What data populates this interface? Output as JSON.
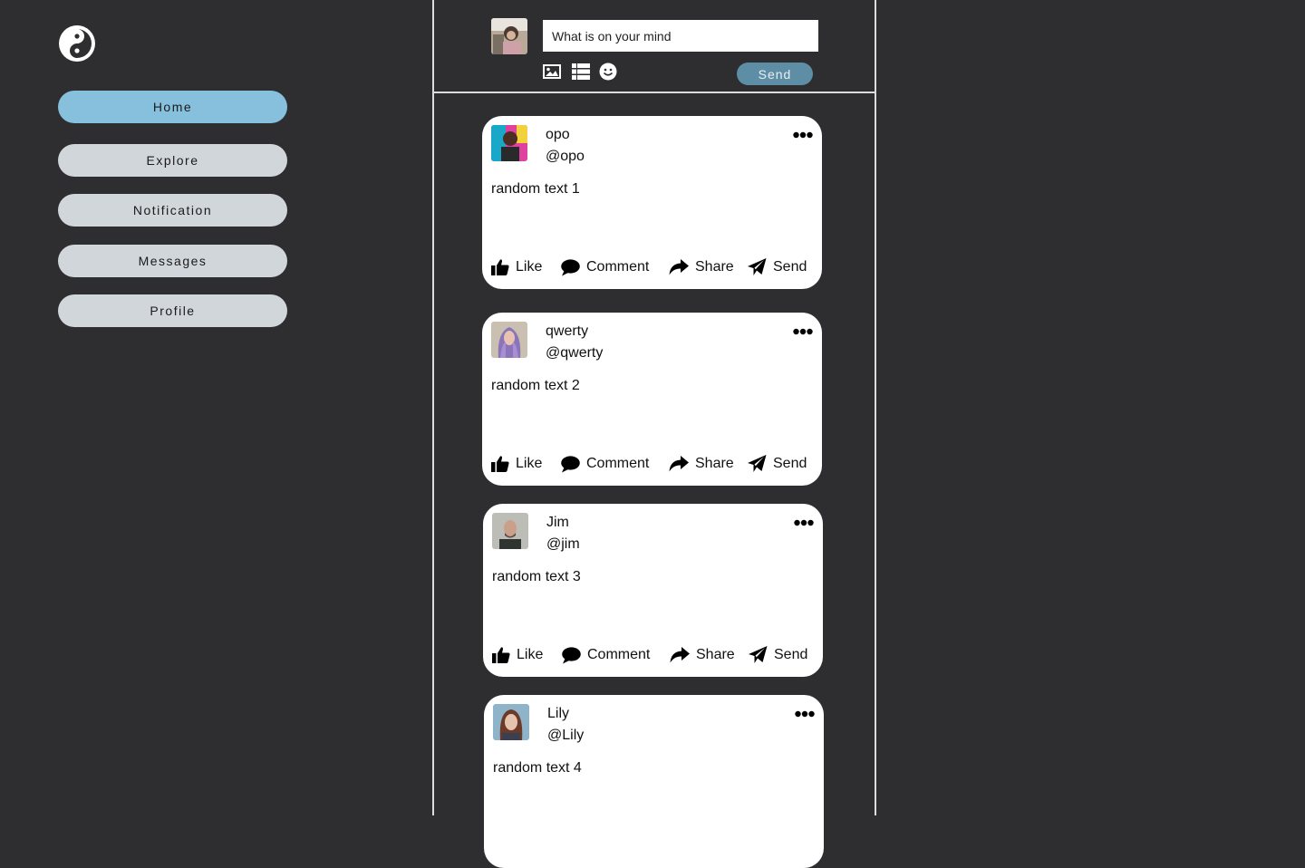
{
  "sidebar": {
    "logo_icon": "yin-yang-icon",
    "items": [
      {
        "label": "Home",
        "active": true
      },
      {
        "label": "Explore",
        "active": false
      },
      {
        "label": "Notification",
        "active": false
      },
      {
        "label": "Messages",
        "active": false
      },
      {
        "label": "Profile",
        "active": false
      }
    ]
  },
  "composer": {
    "placeholder": "What is on your mind",
    "tools": [
      "image-icon",
      "list-icon",
      "smiley-icon"
    ],
    "send_label": "Send"
  },
  "posts": [
    {
      "name": "opo",
      "handle": "@opo",
      "text": "random text 1"
    },
    {
      "name": "qwerty",
      "handle": "@qwerty",
      "text": "random text 2"
    },
    {
      "name": "Jim",
      "handle": "@jim",
      "text": "random text 3"
    },
    {
      "name": "Lily",
      "handle": "@Lily",
      "text": "random text 4"
    }
  ],
  "actions": {
    "like": "Like",
    "comment": "Comment",
    "share": "Share",
    "send": "Send"
  },
  "colors": {
    "background": "#2e2e30",
    "nav_active": "#86c0dc",
    "nav_default": "#d1d6db",
    "send_button": "#5e8ea6"
  }
}
